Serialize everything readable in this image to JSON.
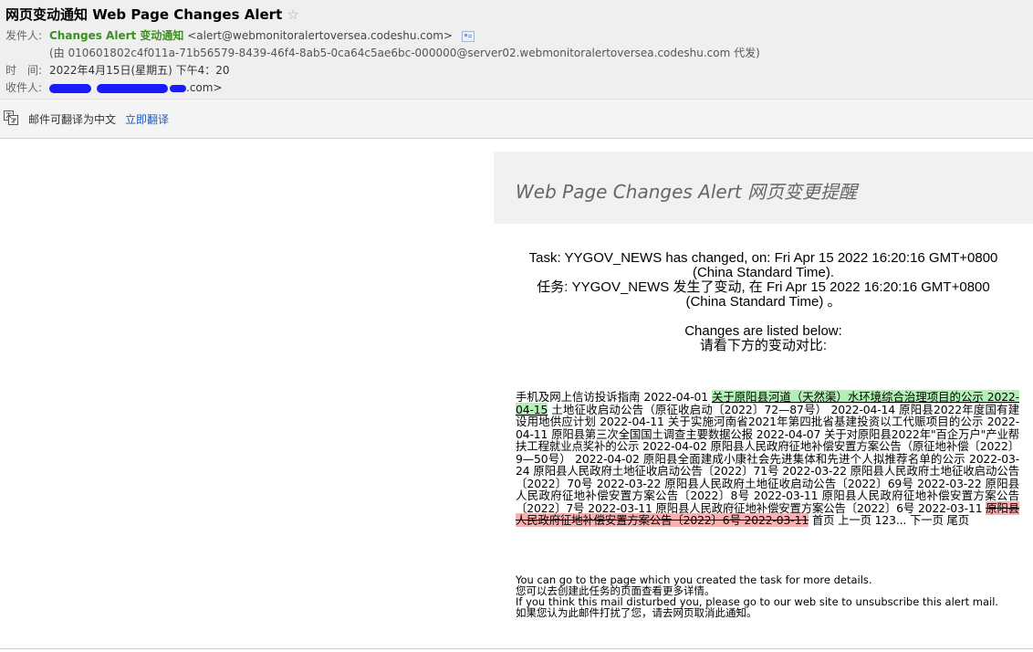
{
  "header": {
    "subject": "网页变动通知 Web Page Changes Alert",
    "star_glyph": "☆",
    "from_label": "发件人:",
    "sender_name": "Changes Alert 变动通知",
    "sender_email": "<alert@webmonitoralertoversea.codeshu.com>",
    "proxy_line": "(由 010601802c4f011a-71b56579-8439-46f4-8ab5-0ca64c5ae6bc-000000@server02.webmonitoralertoversea.codeshu.com 代发)",
    "time_label": "时　间:",
    "time_value": "2022年4月15日(星期五) 下午4：20",
    "to_label": "收件人:",
    "to_suffix": ".com>"
  },
  "translate_bar": {
    "text": "邮件可翻译为中文",
    "link": "立即翻译",
    "icon": "translate-icon"
  },
  "mail": {
    "banner_title": "Web Page Changes Alert 网页变更提醒",
    "task_en_1": "Task: YYGOV_NEWS has changed, on: Fri Apr 15 2022 16:20:16 GMT+0800",
    "task_en_2": "(China Standard Time).",
    "task_cn_1": "任务: YYGOV_NEWS 发生了变动, 在 Fri Apr 15 2022 16:20:16 GMT+0800",
    "task_cn_2": "(China Standard Time) 。",
    "changes_en": "Changes are listed below:",
    "changes_cn": "请看下方的变动对比:",
    "diff_pre": "手机及网上信访投诉指南 2022-04-01 ",
    "diff_inserted": "关于原阳县河道（天然渠）水环境综合治理项目的公示 2022-04-15",
    "diff_mid": " 土地征收启动公告（原征收启动〔2022〕72—87号） 2022-04-14 原阳县2022年度国有建设用地供应计划 2022-04-11 关于实施河南省2021年第四批省基建投资以工代赈项目的公示 2022-04-11 原阳县第三次全国国土调查主要数据公报 2022-04-07 关于对原阳县2022年\"百企万户\"产业帮扶工程就业点奖补的公示 2022-04-02 原阳县人民政府征地补偿安置方案公告（原征地补偿〔2022〕9—50号） 2022-04-02 原阳县全面建成小康社会先进集体和先进个人拟推荐名单的公示 2022-03-24 原阳县人民政府土地征收启动公告〔2022〕71号 2022-03-22 原阳县人民政府土地征收启动公告〔2022〕70号 2022-03-22 原阳县人民政府土地征收启动公告〔2022〕69号 2022-03-22 原阳县人民政府征地补偿安置方案公告〔2022〕8号 2022-03-11 原阳县人民政府征地补偿安置方案公告〔2022〕7号 2022-03-11 原阳县人民政府征地补偿安置方案公告〔2022〕6号 2022-03-11 ",
    "diff_deleted": "原阳县人民政府征地补偿安置方案公告〔2022〕6号 2022-03-11",
    "diff_post": " 首页 上一页 123... 下一页 尾页",
    "footer_1": "You can go to the page which you created the task for more details.",
    "footer_2": "您可以去创建此任务的页面查看更多详情。",
    "footer_3": "If you think this mail disturbed you, please go to our web site to unsubscribe this alert mail.",
    "footer_4": "如果您认为此邮件打扰了您，请去网页取消此通知。"
  },
  "colors": {
    "sender_green": "#3a8f1e",
    "link_blue": "#1a5cc8",
    "inserted_bg": "#b3f0b3",
    "deleted_bg": "#f8b0b0"
  }
}
